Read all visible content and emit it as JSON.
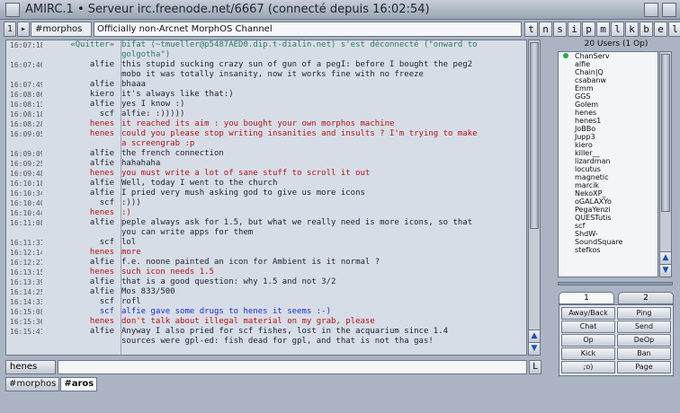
{
  "window": {
    "title": "AMIRC.1 • Serveur irc.freenode.net/6667 (connecté depuis 16:02:54)"
  },
  "toolbar": {
    "small_buttons": [
      "1",
      "▸"
    ],
    "channel": "#morphos",
    "topic": "Officially non-Arcnet MorphOS Channel",
    "modes": [
      "t",
      "n",
      "s",
      "i",
      "p",
      "m",
      "l",
      "k",
      "b",
      "e",
      "l"
    ]
  },
  "messages": [
    {
      "time": "16:07:18",
      "nick": "«Quitter»",
      "text": "bifat (~tmueller@p5487AED0.dip.t-dialin.net) s'est déconnecté (\"onward to",
      "color": "teal"
    },
    {
      "time": "",
      "nick": "",
      "text": "golgotha\")",
      "color": "teal"
    },
    {
      "time": "16:07:46",
      "nick": "alfie",
      "text": "this stupid sucking crazy sun of gun of a pegI: before I bought the peg2",
      "color": "normal"
    },
    {
      "time": "",
      "nick": "",
      "text": "mobo it was totally insanity, now it works fine with no freeze",
      "color": "normal"
    },
    {
      "time": "16:07:49",
      "nick": "alfie",
      "text": "bhaaa",
      "color": "normal"
    },
    {
      "time": "16:08:06",
      "nick": "kiero",
      "text": "it's always like that:)",
      "color": "normal"
    },
    {
      "time": "16:08:13",
      "nick": "alfie",
      "text": "yes I know :)",
      "color": "normal"
    },
    {
      "time": "16:08:18",
      "nick": "scf",
      "text": "alfie: :)))))",
      "color": "normal"
    },
    {
      "time": "16:08:28",
      "nick": "henes",
      "text": "it reached its aim : you bought your own morphos machine",
      "color": "red"
    },
    {
      "time": "16:09:05",
      "nick": "henes",
      "text": "could you please stop writing insanities and insults ? I'm trying to make",
      "color": "red"
    },
    {
      "time": "",
      "nick": "",
      "text": "a screengrab :p",
      "color": "red"
    },
    {
      "time": "16:09:09",
      "nick": "alfie",
      "text": "the french connection",
      "color": "normal"
    },
    {
      "time": "16:09:25",
      "nick": "alfie",
      "text": "hahahaha",
      "color": "normal"
    },
    {
      "time": "16:09:48",
      "nick": "henes",
      "text": "you must write a lot of sane stuff to scroll it out",
      "color": "red"
    },
    {
      "time": "16:10:18",
      "nick": "alfie",
      "text": "Well, today I went to the church",
      "color": "normal"
    },
    {
      "time": "16:10:34",
      "nick": "alfie",
      "text": "I pried very mush asking god to give us more icons",
      "color": "normal"
    },
    {
      "time": "16:10:40",
      "nick": "scf",
      "text": ":)))",
      "color": "normal"
    },
    {
      "time": "16:10:44",
      "nick": "henes",
      "text": ":)",
      "color": "red"
    },
    {
      "time": "16:11:08",
      "nick": "alfie",
      "text": "peple always ask for 1.5, but what we really need is more icons, so that",
      "color": "normal"
    },
    {
      "time": "",
      "nick": "",
      "text": "you can write apps for them",
      "color": "normal"
    },
    {
      "time": "16:11:31",
      "nick": "scf",
      "text": "lol",
      "color": "normal"
    },
    {
      "time": "16:12:14",
      "nick": "henes",
      "text": "more",
      "color": "red"
    },
    {
      "time": "16:12:21",
      "nick": "alfie",
      "text": "f.e. noone painted an icon for Ambient is it normal ?",
      "color": "normal"
    },
    {
      "time": "16:13:15",
      "nick": "henes",
      "text": "such icon needs 1.5",
      "color": "red"
    },
    {
      "time": "16:13:39",
      "nick": "alfie",
      "text": "that is a good question: why 1.5 and not 3/2",
      "color": "normal"
    },
    {
      "time": "16:14:25",
      "nick": "alfie",
      "text": "Mos 833/500",
      "color": "normal"
    },
    {
      "time": "16:14:33",
      "nick": "scf",
      "text": "rofl",
      "color": "normal"
    },
    {
      "time": "16:15:08",
      "nick": "scf",
      "text": "alfie gave some drugs to henes it seems :-)",
      "color": "blue"
    },
    {
      "time": "16:15:36",
      "nick": "henes",
      "text": "don't talk about illegal material on my grab, please",
      "color": "red"
    },
    {
      "time": "16:15:41",
      "nick": "alfie",
      "text": "Anyway I also pried for scf fishes, lost in the acquarium since 1.4",
      "color": "normal"
    },
    {
      "time": "",
      "nick": "",
      "text": "sources were gpl-ed: fish dead for gpl, and that is not tha gas!",
      "color": "normal"
    }
  ],
  "input": {
    "nick": "henes",
    "value": "",
    "lock_label": "L"
  },
  "tabs": [
    {
      "label": "#morphos",
      "active": false
    },
    {
      "label": "#aros",
      "active": true
    }
  ],
  "userlist": {
    "header": "20 Users (1 Op)",
    "users": [
      {
        "name": "ChanServ",
        "op": true
      },
      {
        "name": "alfie",
        "op": false
      },
      {
        "name": "Chain|Q",
        "op": false
      },
      {
        "name": "csabanw",
        "op": false
      },
      {
        "name": "Emm",
        "op": false
      },
      {
        "name": "GGS",
        "op": false
      },
      {
        "name": "Golem",
        "op": false
      },
      {
        "name": "henes",
        "op": false
      },
      {
        "name": "henes1",
        "op": false
      },
      {
        "name": "JoBBo",
        "op": false
      },
      {
        "name": "Jupp3",
        "op": false
      },
      {
        "name": "kiero",
        "op": false
      },
      {
        "name": "killer__",
        "op": false
      },
      {
        "name": "lizardman",
        "op": false
      },
      {
        "name": "locutus",
        "op": false
      },
      {
        "name": "magnetic",
        "op": false
      },
      {
        "name": "marcik",
        "op": false
      },
      {
        "name": "NekoXP_",
        "op": false
      },
      {
        "name": "oGALAXYo",
        "op": false
      },
      {
        "name": "PegaYenzi",
        "op": false
      },
      {
        "name": "QUESTutis",
        "op": false
      },
      {
        "name": "scf",
        "op": false
      },
      {
        "name": "ShdW-",
        "op": false
      },
      {
        "name": "SoundSquare",
        "op": false
      },
      {
        "name": "stefkos",
        "op": false
      }
    ]
  },
  "button_tabs": [
    "1",
    "2"
  ],
  "buttons": [
    "Away/Back",
    "Ping",
    "Chat",
    "Send",
    "Op",
    "DeOp",
    "Kick",
    "Ban",
    ";o)",
    "Page"
  ],
  "colors": {
    "normal": "#1b2230",
    "red": "#b4121b",
    "blue": "#1c2fd2",
    "teal": "#2b7b63",
    "op": "#2ca74a"
  },
  "icons": {
    "scroll_up": "arrow-up-icon",
    "scroll_down": "arrow-down-icon",
    "op_indicator": "green-dot-icon"
  }
}
